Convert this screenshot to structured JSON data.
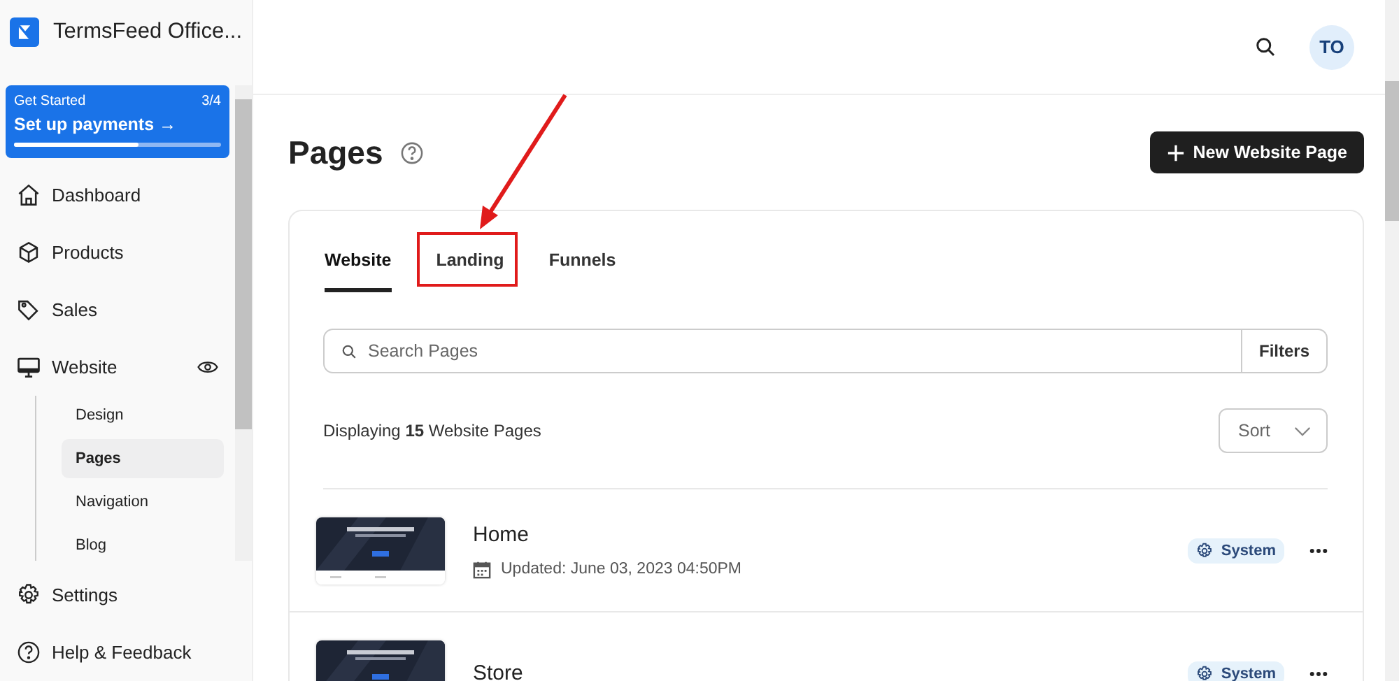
{
  "workspace": {
    "name": "TermsFeed Office..."
  },
  "onboarding": {
    "label": "Get Started",
    "progress_text": "3/4",
    "action": "Set up payments",
    "arrow": "→",
    "level": 0.6
  },
  "nav": [
    {
      "label": "Dashboard"
    },
    {
      "label": "Products"
    },
    {
      "label": "Sales"
    },
    {
      "label": "Website",
      "expanded": true,
      "children": [
        {
          "label": "Design",
          "selected": false
        },
        {
          "label": "Pages",
          "selected": true
        },
        {
          "label": "Navigation",
          "selected": false
        },
        {
          "label": "Blog",
          "selected": false
        }
      ]
    }
  ],
  "footer_nav": [
    {
      "label": "Settings"
    },
    {
      "label": "Help & Feedback"
    }
  ],
  "header": {
    "avatar": "TO"
  },
  "page": {
    "title": "Pages",
    "new_button": "New Website Page"
  },
  "tabs": [
    {
      "label": "Website",
      "selected": true
    },
    {
      "label": "Landing",
      "selected": false
    },
    {
      "label": "Funnels",
      "selected": false
    }
  ],
  "search": {
    "placeholder": "Search Pages",
    "filters": "Filters"
  },
  "summary": {
    "text": "Displaying **15** Website Pages"
  },
  "sort": {
    "label": "Sort"
  },
  "rows": [
    {
      "name": "Home",
      "updated": "Updated: June 03, 2023 04:50PM",
      "badge": "System"
    },
    {
      "name": "Store",
      "badge": "System"
    }
  ]
}
